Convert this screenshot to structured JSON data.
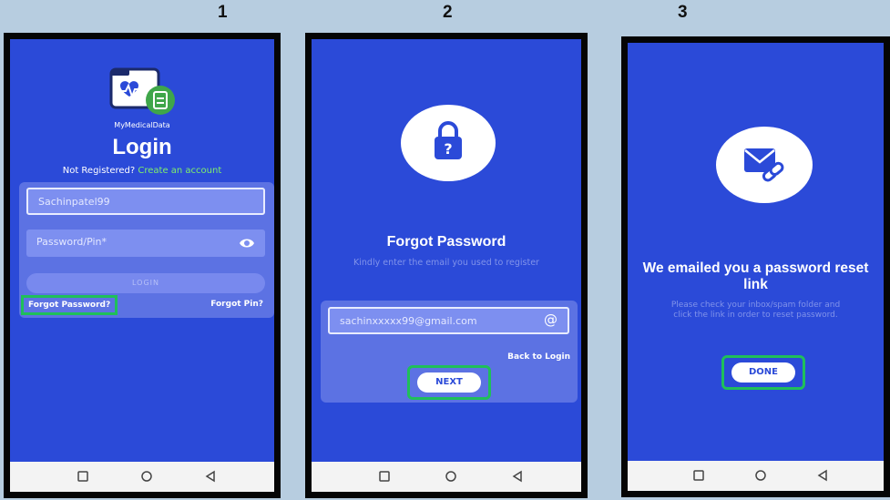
{
  "steps": [
    "1",
    "2",
    "3"
  ],
  "screen1": {
    "app_name": "MyMedicalData",
    "title": "Login",
    "not_registered": "Not Registered?",
    "create_account": "Create an account",
    "username_value": "Sachinpatel99",
    "password_placeholder": "Password/Pin*",
    "login_button": "LOGIN",
    "forgot_password": "Forgot Password?",
    "forgot_pin": "Forgot Pin?"
  },
  "screen2": {
    "title": "Forgot Password",
    "subtitle": "Kindly enter the email you used to register",
    "email_value": "sachinxxxxx99@gmail.com",
    "back_to_login": "Back to Login",
    "next_button": "NEXT"
  },
  "screen3": {
    "title": "We emailed you a password reset link",
    "message": "Please check your inbox/spam folder and click the link in order to reset password.",
    "done_button": "DONE"
  },
  "colors": {
    "screen_bg": "#2b4ad8",
    "highlight": "#1fbf5a",
    "link_green": "#7ff06a"
  }
}
